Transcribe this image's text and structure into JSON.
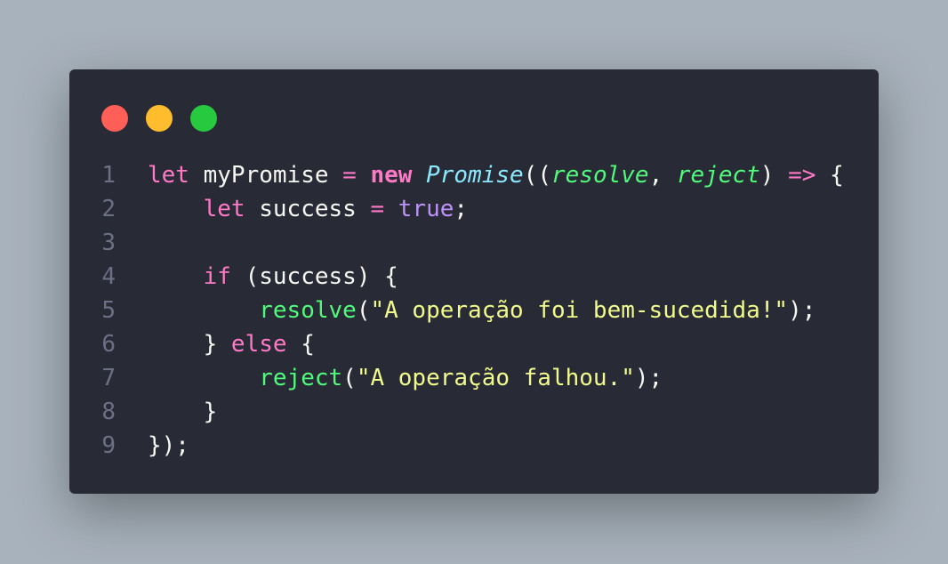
{
  "window": {
    "controls": [
      {
        "name": "close",
        "color": "#ff5f56"
      },
      {
        "name": "minimize",
        "color": "#ffbd2e"
      },
      {
        "name": "maximize",
        "color": "#27c93f"
      }
    ]
  },
  "code": {
    "language": "javascript",
    "lines": [
      {
        "number": "1",
        "tokens": [
          {
            "t": "let",
            "c": "kw"
          },
          {
            "t": " myPromise ",
            "c": "plain"
          },
          {
            "t": "=",
            "c": "op"
          },
          {
            "t": " ",
            "c": "plain"
          },
          {
            "t": "new",
            "c": "kw-bold"
          },
          {
            "t": " ",
            "c": "plain"
          },
          {
            "t": "Promise",
            "c": "cls"
          },
          {
            "t": "((",
            "c": "plain"
          },
          {
            "t": "resolve",
            "c": "param"
          },
          {
            "t": ", ",
            "c": "plain"
          },
          {
            "t": "reject",
            "c": "param"
          },
          {
            "t": ") ",
            "c": "plain"
          },
          {
            "t": "=>",
            "c": "op"
          },
          {
            "t": " {",
            "c": "plain"
          }
        ]
      },
      {
        "number": "2",
        "tokens": [
          {
            "t": "    ",
            "c": "plain"
          },
          {
            "t": "let",
            "c": "kw"
          },
          {
            "t": " success ",
            "c": "plain"
          },
          {
            "t": "=",
            "c": "op"
          },
          {
            "t": " ",
            "c": "plain"
          },
          {
            "t": "true",
            "c": "bool"
          },
          {
            "t": ";",
            "c": "plain"
          }
        ]
      },
      {
        "number": "3",
        "tokens": []
      },
      {
        "number": "4",
        "tokens": [
          {
            "t": "    ",
            "c": "plain"
          },
          {
            "t": "if",
            "c": "kw"
          },
          {
            "t": " (success) {",
            "c": "plain"
          }
        ]
      },
      {
        "number": "5",
        "tokens": [
          {
            "t": "        ",
            "c": "plain"
          },
          {
            "t": "resolve",
            "c": "fn"
          },
          {
            "t": "(",
            "c": "plain"
          },
          {
            "t": "\"A operação foi bem-sucedida!\"",
            "c": "str"
          },
          {
            "t": ");",
            "c": "plain"
          }
        ]
      },
      {
        "number": "6",
        "tokens": [
          {
            "t": "    } ",
            "c": "plain"
          },
          {
            "t": "else",
            "c": "kw"
          },
          {
            "t": " {",
            "c": "plain"
          }
        ]
      },
      {
        "number": "7",
        "tokens": [
          {
            "t": "        ",
            "c": "plain"
          },
          {
            "t": "reject",
            "c": "fn"
          },
          {
            "t": "(",
            "c": "plain"
          },
          {
            "t": "\"A operação falhou.\"",
            "c": "str"
          },
          {
            "t": ");",
            "c": "plain"
          }
        ]
      },
      {
        "number": "8",
        "tokens": [
          {
            "t": "    }",
            "c": "plain"
          }
        ]
      },
      {
        "number": "9",
        "tokens": [
          {
            "t": "});",
            "c": "plain"
          }
        ]
      }
    ]
  }
}
